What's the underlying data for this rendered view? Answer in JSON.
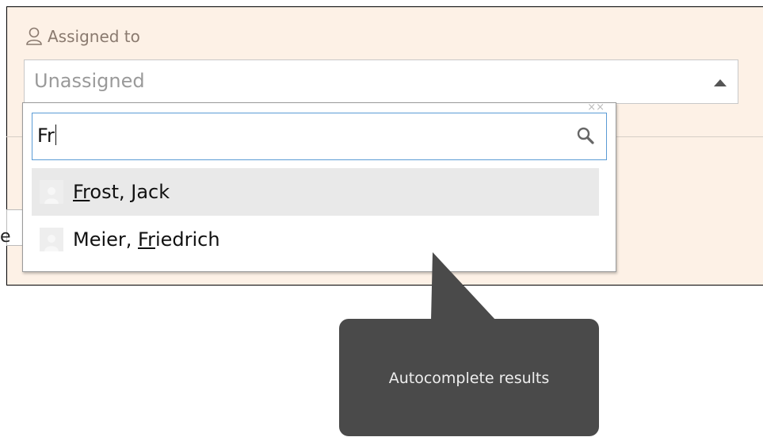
{
  "field": {
    "label": "Assigned to",
    "icon": "user-icon",
    "current_value": "Unassigned"
  },
  "search": {
    "query": "Fr",
    "icon": "search-icon"
  },
  "results": [
    {
      "pre": "",
      "match": "Fr",
      "post": "ost, Jack",
      "highlighted": true
    },
    {
      "pre": "Meier, ",
      "match": "Fr",
      "post": "iedrich",
      "highlighted": false
    }
  ],
  "background": {
    "fragment": "e"
  },
  "tooltip": {
    "text": "Autocomplete results"
  },
  "colors": {
    "panel_bg": "#fdf1e6",
    "search_border": "#5b9bd5",
    "tooltip_bg": "#4a4a4a",
    "highlight_bg": "#e9e9e9"
  }
}
